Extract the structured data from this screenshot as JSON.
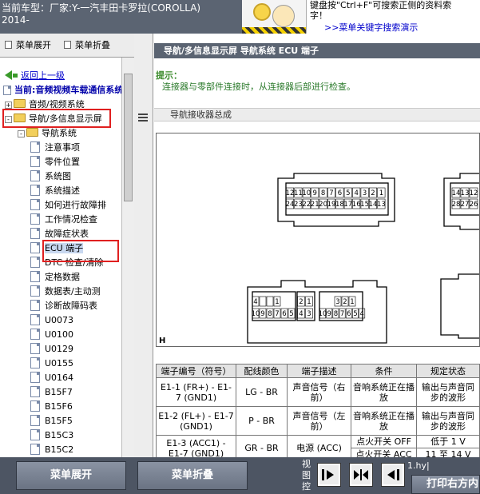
{
  "header": {
    "car_model_line1": "当前车型：厂家:Y-一汽丰田卡罗拉(COROLLA)",
    "car_model_line2": "2014-",
    "hint_line1": "键盘按\"Ctrl+F\"可搜索正侧的资料索",
    "hint_line2": "字！",
    "demo_link": ">>菜单关键字搜索演示"
  },
  "left_panel": {
    "tab_expand": "菜单展开",
    "tab_collapse": "菜单折叠",
    "back_link": "返回上一级",
    "current_system": "当前:音频视频车载通信系统",
    "tree": [
      {
        "label": "音频/视频系统",
        "type": "folder"
      },
      {
        "label": "导航/多信息显示屏",
        "type": "folder"
      },
      {
        "label": "导航系统",
        "type": "folder"
      },
      {
        "label": "注意事项",
        "type": "doc"
      },
      {
        "label": "零件位置",
        "type": "doc"
      },
      {
        "label": "系统图",
        "type": "doc"
      },
      {
        "label": "系统描述",
        "type": "doc"
      },
      {
        "label": "如何进行故障排",
        "type": "doc"
      },
      {
        "label": "工作情况检查",
        "type": "doc"
      },
      {
        "label": "故障症状表",
        "type": "doc"
      },
      {
        "label": "ECU 端子",
        "type": "doc"
      },
      {
        "label": "DTC 检查/清除",
        "type": "doc"
      },
      {
        "label": "定格数据",
        "type": "doc"
      },
      {
        "label": "数据表/主动测",
        "type": "doc"
      },
      {
        "label": "诊断故障码表",
        "type": "doc"
      },
      {
        "label": "U0073",
        "type": "doc"
      },
      {
        "label": "U0100",
        "type": "doc"
      },
      {
        "label": "U0129",
        "type": "doc"
      },
      {
        "label": "U0155",
        "type": "doc"
      },
      {
        "label": "U0164",
        "type": "doc"
      },
      {
        "label": "B15F7",
        "type": "doc"
      },
      {
        "label": "B15F6",
        "type": "doc"
      },
      {
        "label": "B15F5",
        "type": "doc"
      },
      {
        "label": "B15C3",
        "type": "doc"
      },
      {
        "label": "B15C2",
        "type": "doc"
      }
    ]
  },
  "content": {
    "title": "导航/多信息显示屏  导航系统  ECU 端子",
    "hint_label": "提示：",
    "hint_body": "连接器与零部件连接时，从连接器后部进行检查。",
    "section_title": "导航接收器总成",
    "diagram_marker": "H",
    "connectors": {
      "c1_top": [
        "12",
        "11",
        "10",
        "9",
        "8",
        "7",
        "6",
        "5",
        "4",
        "3",
        "2",
        "1"
      ],
      "c1_bottom": [
        "24",
        "23",
        "22",
        "21",
        "20",
        "19",
        "18",
        "17",
        "16",
        "15",
        "14",
        "13"
      ],
      "c2_top": [
        "14",
        "13",
        "12"
      ],
      "c2_bottom": [
        "28",
        "27",
        "26"
      ],
      "c3_left_top": [
        "4",
        "",
        "",
        "1"
      ],
      "c3_left_bottom": [
        "10",
        "9",
        "8",
        "7",
        "6",
        "5"
      ],
      "c3_mid_top": [
        "2",
        "1"
      ],
      "c3_mid_bottom": [
        "4",
        "3"
      ],
      "c3_right_top": [
        "3",
        "2",
        "1"
      ],
      "c3_right_bottom": [
        "10",
        "9",
        "8",
        "7",
        "6",
        "5",
        "4"
      ]
    },
    "table": {
      "headers": [
        "端子编号（符号）",
        "配线颜色",
        "端子描述",
        "条件",
        "规定状态"
      ],
      "rows": [
        {
          "terminal": "E1-1 (FR+) - E1-7 (GND1)",
          "color": "LG - BR",
          "desc": "声音信号（右前）",
          "condition": "音响系统正在播放",
          "spec": "输出与声音同步的波形"
        },
        {
          "terminal": "E1-2 (FL+) - E1-7 (GND1)",
          "color": "P - BR",
          "desc": "声音信号（左前）",
          "condition": "音响系统正在播放",
          "spec": "输出与声音同步的波形"
        },
        {
          "terminal": "E1-3 (ACC1) - E1-7 (GND1)",
          "color": "GR - BR",
          "desc": "电源 (ACC)",
          "condition": "点火开关 OFF",
          "condition2": "点火开关 ACC",
          "spec": "低于 1 V",
          "spec2": "11 至 14 V"
        }
      ]
    }
  },
  "bottom": {
    "expand_button": "菜单展开",
    "collapse_button": "菜单折叠",
    "view_label": "视图控",
    "hy_label": "1.hy|",
    "print_button": "打印右方内"
  }
}
